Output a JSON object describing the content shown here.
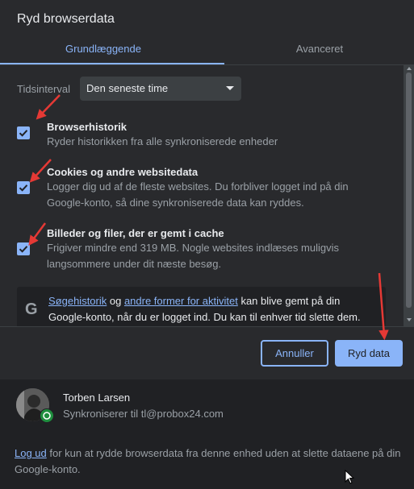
{
  "dialog": {
    "title": "Ryd browserdata"
  },
  "tabs": [
    {
      "label": "Grundlæggende",
      "selected": true
    },
    {
      "label": "Avanceret",
      "selected": false
    }
  ],
  "time_range": {
    "label": "Tidsinterval",
    "selected": "Den seneste time"
  },
  "options": [
    {
      "title": "Browserhistorik",
      "description": "Ryder historikken fra alle synkroniserede enheder",
      "checked": true
    },
    {
      "title": "Cookies og andre websitedata",
      "description": "Logger dig ud af de fleste websites. Du forbliver logget ind på din Google-konto, så dine synkroniserede data kan ryddes.",
      "checked": true
    },
    {
      "title": "Billeder og filer, der er gemt i cache",
      "description": "Frigiver mindre end 319 MB. Nogle websites indlæses muligvis langsommere under dit næste besøg.",
      "checked": true
    }
  ],
  "info": {
    "icon": "google-g-icon",
    "link1": "Søgehistorik",
    "text1": " og ",
    "link2": "andre former for aktivitet",
    "text2": " kan blive gemt på din Google-konto, når du er logget ind. Du kan til enhver tid slette dem."
  },
  "buttons": {
    "cancel": "Annuller",
    "clear": "Ryd data"
  },
  "account": {
    "name": "Torben Larsen",
    "sync_text": "Synkroniserer til tl@probox24.com"
  },
  "footer": {
    "logout_link": "Log ud",
    "logout_text": " for kun at rydde browserdata fra denne enhed uden at slette dataene på din Google-konto."
  },
  "colors": {
    "accent": "#8ab4f8",
    "background": "#292a2d",
    "annotation_arrow": "#e53935"
  }
}
